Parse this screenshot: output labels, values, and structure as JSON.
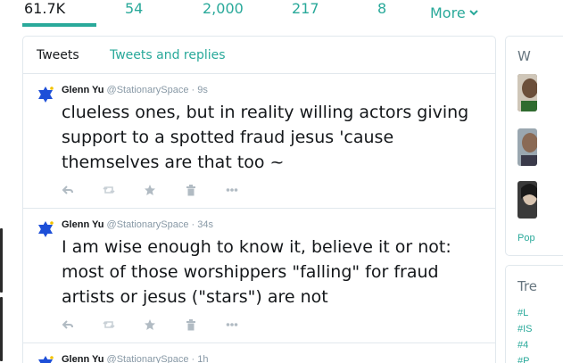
{
  "stats": {
    "tweets": "61.7K",
    "following": "54",
    "followers": "2,000",
    "likes": "217",
    "lists": "8",
    "more": "More"
  },
  "tabs": {
    "tweets": "Tweets",
    "tweets_and_replies": "Tweets and replies"
  },
  "tweets": [
    {
      "name": "Glenn Yu",
      "handle": "@StationarySpace",
      "time": "· 9s",
      "text": "clueless ones, but in reality willing actors giving support to a spotted fraud jesus 'cause themselves are that too ~"
    },
    {
      "name": "Glenn Yu",
      "handle": "@StationarySpace",
      "time": "· 34s",
      "text": "I am wise enough to know it,  believe it or not:  most of those worshippers \"falling\" for fraud artists or jesus (\"stars\") are not"
    },
    {
      "name": "Glenn Yu",
      "handle": "@StationarySpace",
      "time": "· 1h",
      "text": ""
    }
  ],
  "sidebar": {
    "who_to_follow_title": "W",
    "popular_link": "Pop",
    "trends_title": "Tre",
    "trends": [
      "#L",
      "#IS",
      "#4",
      "#P"
    ]
  },
  "colors": {
    "accent": "#29a99a",
    "text": "#14171a",
    "muted": "#8899a6",
    "star": "#1d4fd8"
  }
}
